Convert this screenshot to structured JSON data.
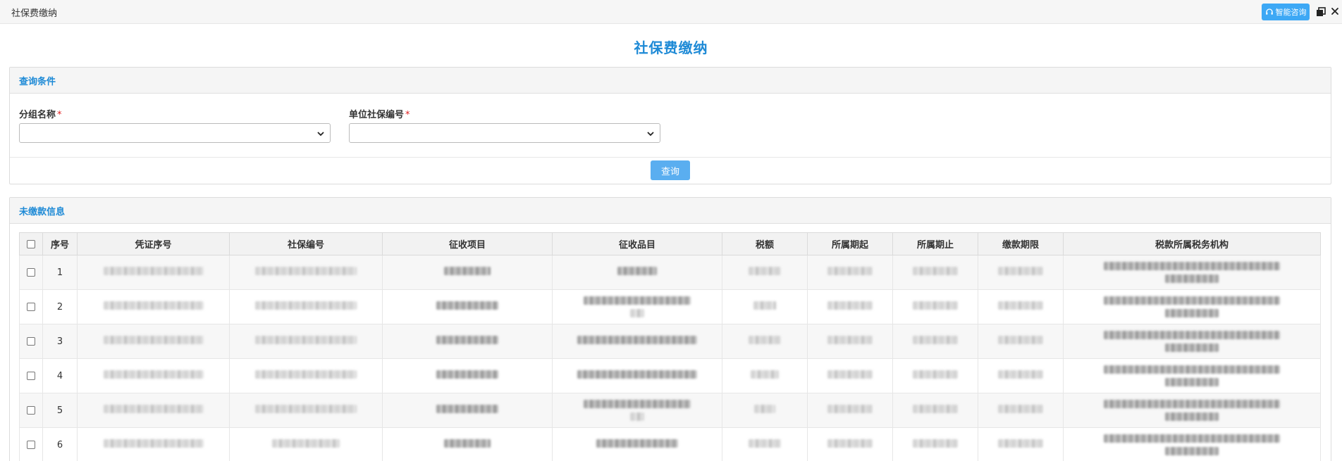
{
  "tab": {
    "title": "社保费缴纳",
    "help_label": "智能咨询"
  },
  "page": {
    "title": "社保费缴纳"
  },
  "query": {
    "section_title": "查询条件",
    "group_name_label": "分组名称",
    "unit_code_label": "单位社保编号",
    "required_mark": "*",
    "group_name_value": "",
    "unit_code_value": "",
    "search_button": "查询"
  },
  "unpaid": {
    "section_title": "未缴款信息",
    "columns": [
      "序号",
      "凭证序号",
      "社保编号",
      "征收项目",
      "征收品目",
      "税额",
      "所属期起",
      "所属期止",
      "缴款期限",
      "税款所属税务机构"
    ],
    "rows": [
      {
        "no": "1"
      },
      {
        "no": "2"
      },
      {
        "no": "3"
      },
      {
        "no": "4"
      },
      {
        "no": "5"
      },
      {
        "no": "6"
      }
    ]
  },
  "colors": {
    "accent": "#1e8ad6",
    "button": "#5aaef0",
    "help_button": "#3da8f5",
    "required": "#e02020"
  }
}
